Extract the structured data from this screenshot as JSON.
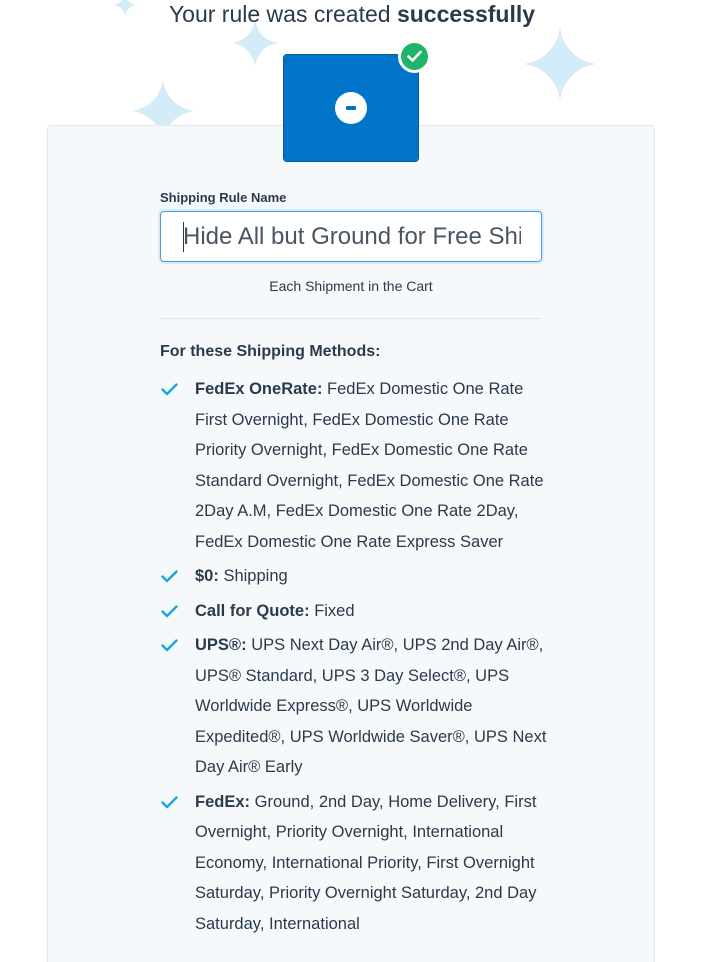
{
  "headline": {
    "prefix": "Your rule was created",
    "emphasis": "successfully"
  },
  "form": {
    "name_label": "Shipping Rule Name",
    "name_value": "Hide All but Ground for Free Shipping",
    "scope_text": "Each Shipment in the Cart"
  },
  "methods": {
    "title": "For these Shipping Methods:",
    "items": [
      {
        "name": "FedEx OneRate:",
        "detail": "FedEx Domestic One Rate First Overnight, FedEx Domestic One Rate Priority Overnight, FedEx Domestic One Rate Standard Overnight, FedEx Domestic One Rate 2Day A.M, FedEx Domestic One Rate 2Day, FedEx Domestic One Rate Express Saver"
      },
      {
        "name": "$0:",
        "detail": "Shipping"
      },
      {
        "name": "Call for Quote:",
        "detail": "Fixed"
      },
      {
        "name": "UPS®:",
        "detail": "UPS Next Day Air®, UPS 2nd Day Air®, UPS® Standard, UPS 3 Day Select®, UPS Worldwide Express®, UPS Worldwide Expedited®, UPS Worldwide Saver®, UPS Next Day Air® Early"
      },
      {
        "name": "FedEx:",
        "detail": "Ground, 2nd Day, Home Delivery, First Overnight, Priority Overnight, International Economy, International Priority, First Overnight Saturday, Priority Overnight Saturday, 2nd Day Saturday, International"
      }
    ]
  },
  "icons": {
    "rule_icon": "minus-circle-icon",
    "success_badge": "check-circle-icon",
    "list_marker": "checkmark-icon",
    "decoration": "sparkle-icon"
  },
  "colors": {
    "rule_box": "#0074c8",
    "success": "#20b36b",
    "checkmark": "#1ca6d9",
    "sparkle": "#d4ecf8",
    "card_bg": "#f5f9fb"
  }
}
